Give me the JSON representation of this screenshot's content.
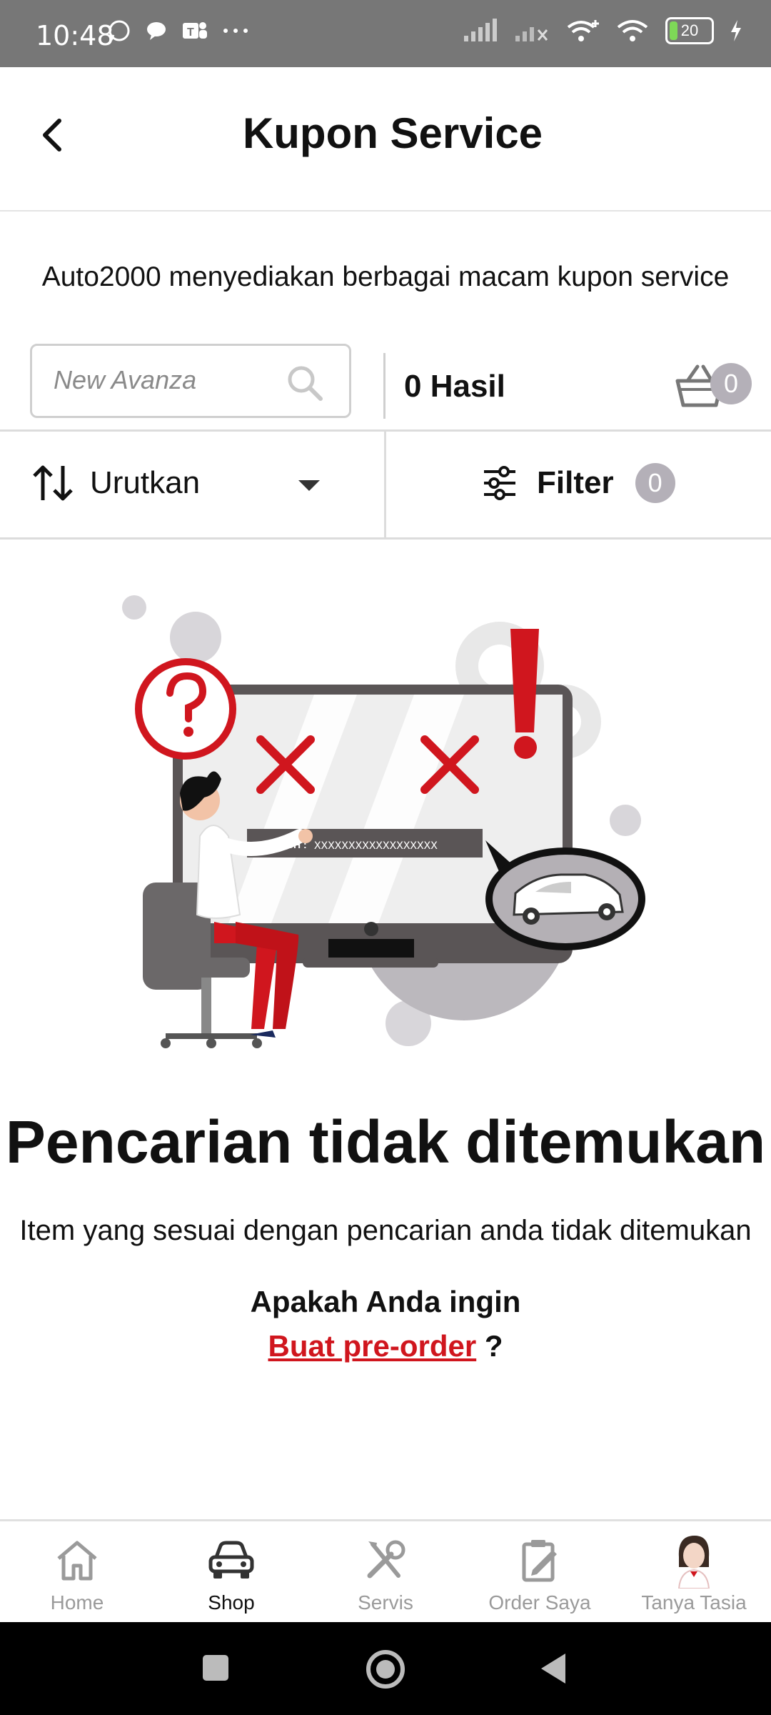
{
  "status_bar": {
    "time": "10:48",
    "battery_level": "20",
    "battery_fraction": 0.2
  },
  "header": {
    "title": "Kupon Service"
  },
  "intro_text": "Auto2000 menyediakan berbagai macam kupon service",
  "search": {
    "placeholder": "New Avanza",
    "result_count": "0 Hasil",
    "cart_badge": "0"
  },
  "sort": {
    "label": "Urutkan"
  },
  "filter": {
    "label": "Filter",
    "badge": "0"
  },
  "illustration": {
    "search_label": "SEARCH :",
    "search_text": "XXXXXXXXXXXXXXXXXX"
  },
  "empty_state": {
    "title": "Pencarian tidak ditemukan",
    "description": "Item yang sesuai dengan pencarian anda tidak ditemukan",
    "question": "Apakah Anda ingin",
    "link_text": "Buat pre-order",
    "question_suffix": "?"
  },
  "bottom_nav": {
    "items": [
      {
        "label": "Home",
        "icon": "home-icon"
      },
      {
        "label": "Shop",
        "icon": "car-icon",
        "active": true
      },
      {
        "label": "Servis",
        "icon": "tools-icon"
      },
      {
        "label": "Order Saya",
        "icon": "clipboard-icon"
      },
      {
        "label": "Tanya Tasia",
        "icon": "assistant-avatar-icon"
      }
    ]
  },
  "colors": {
    "accent_red": "#d0161e",
    "badge_gray": "#b4b0b8",
    "status_bar": "#777777"
  }
}
